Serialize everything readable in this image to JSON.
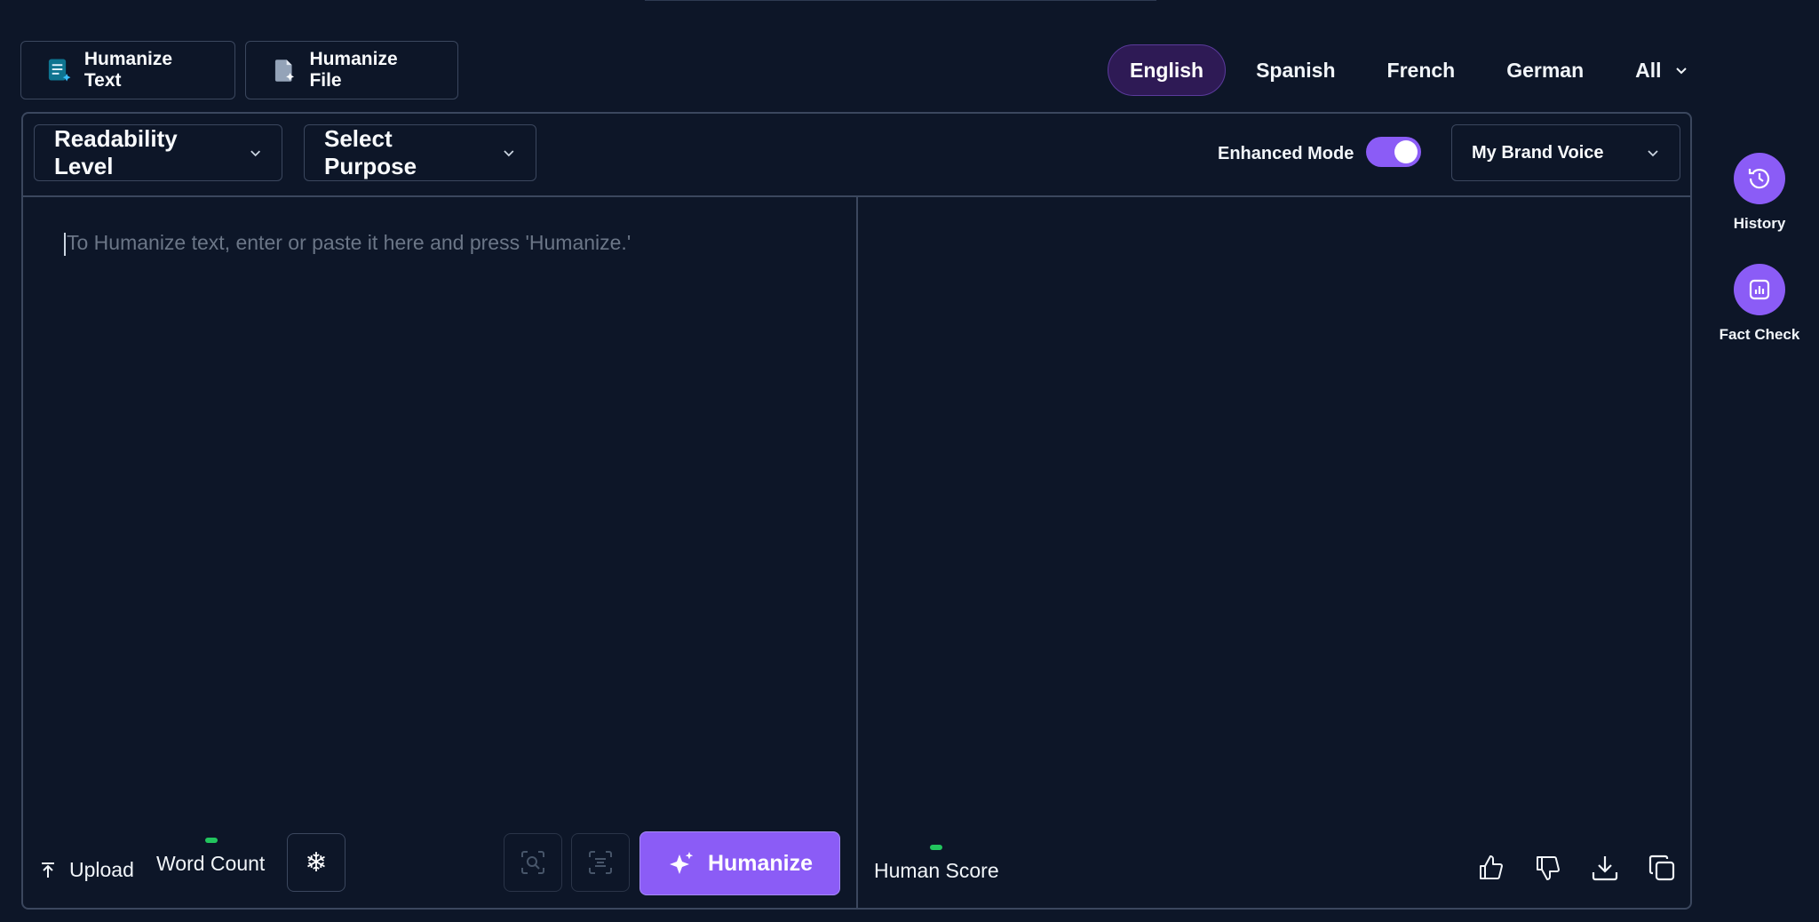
{
  "modes": {
    "humanize_text": "Humanize Text",
    "humanize_file": "Humanize File"
  },
  "languages": {
    "items": [
      "English",
      "Spanish",
      "French",
      "German"
    ],
    "all": "All",
    "selected": "English"
  },
  "toolbar": {
    "readability": "Readability Level",
    "purpose": "Select Purpose",
    "enhanced_mode_label": "Enhanced Mode",
    "enhanced_mode_on": true,
    "brand_voice": "My Brand Voice"
  },
  "input": {
    "placeholder": "To Humanize text, enter or paste it here and press 'Humanize.'"
  },
  "bottom_left": {
    "upload": "Upload",
    "word_count": "Word Count",
    "humanize": "Humanize"
  },
  "bottom_right": {
    "human_score": "Human Score"
  },
  "rail": {
    "history": "History",
    "fact_check": "Fact Check"
  },
  "colors": {
    "background": "#0d1628",
    "accent": "#8b5cf6",
    "border": "#3b475e",
    "indicator": "#22c55e"
  }
}
